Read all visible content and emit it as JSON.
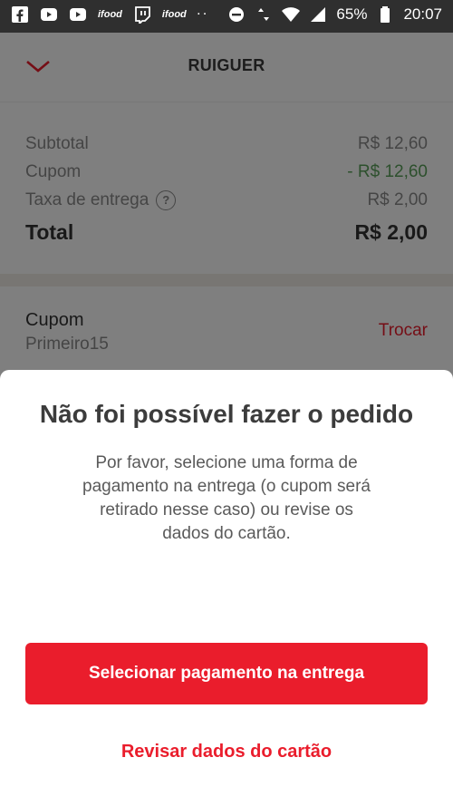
{
  "status_bar": {
    "ifood_label": "ifood",
    "dots": "· ·",
    "battery": "65%",
    "time": "20:07"
  },
  "header": {
    "title": "RUIGUER"
  },
  "summary": {
    "subtotal_label": "Subtotal",
    "subtotal_value": "R$ 12,60",
    "coupon_label": "Cupom",
    "coupon_value": "- R$ 12,60",
    "delivery_label": "Taxa de entrega",
    "delivery_help": "?",
    "delivery_value": "R$ 2,00",
    "total_label": "Total",
    "total_value": "R$ 2,00"
  },
  "coupon_section": {
    "label": "Cupom",
    "code": "Primeiro15",
    "action": "Trocar"
  },
  "dialog": {
    "title": "Não foi possível fazer o pedido",
    "message": "Por favor, selecione uma forma de pagamento na entrega (o cupom será retirado nesse caso) ou revise os dados do cartão.",
    "primary_button": "Selecionar pagamento na entrega",
    "secondary_button": "Revisar dados do cartão"
  },
  "colors": {
    "accent": "#ea1d2c",
    "discount": "#5aa05a",
    "status_bar": "#2f2f2f"
  }
}
